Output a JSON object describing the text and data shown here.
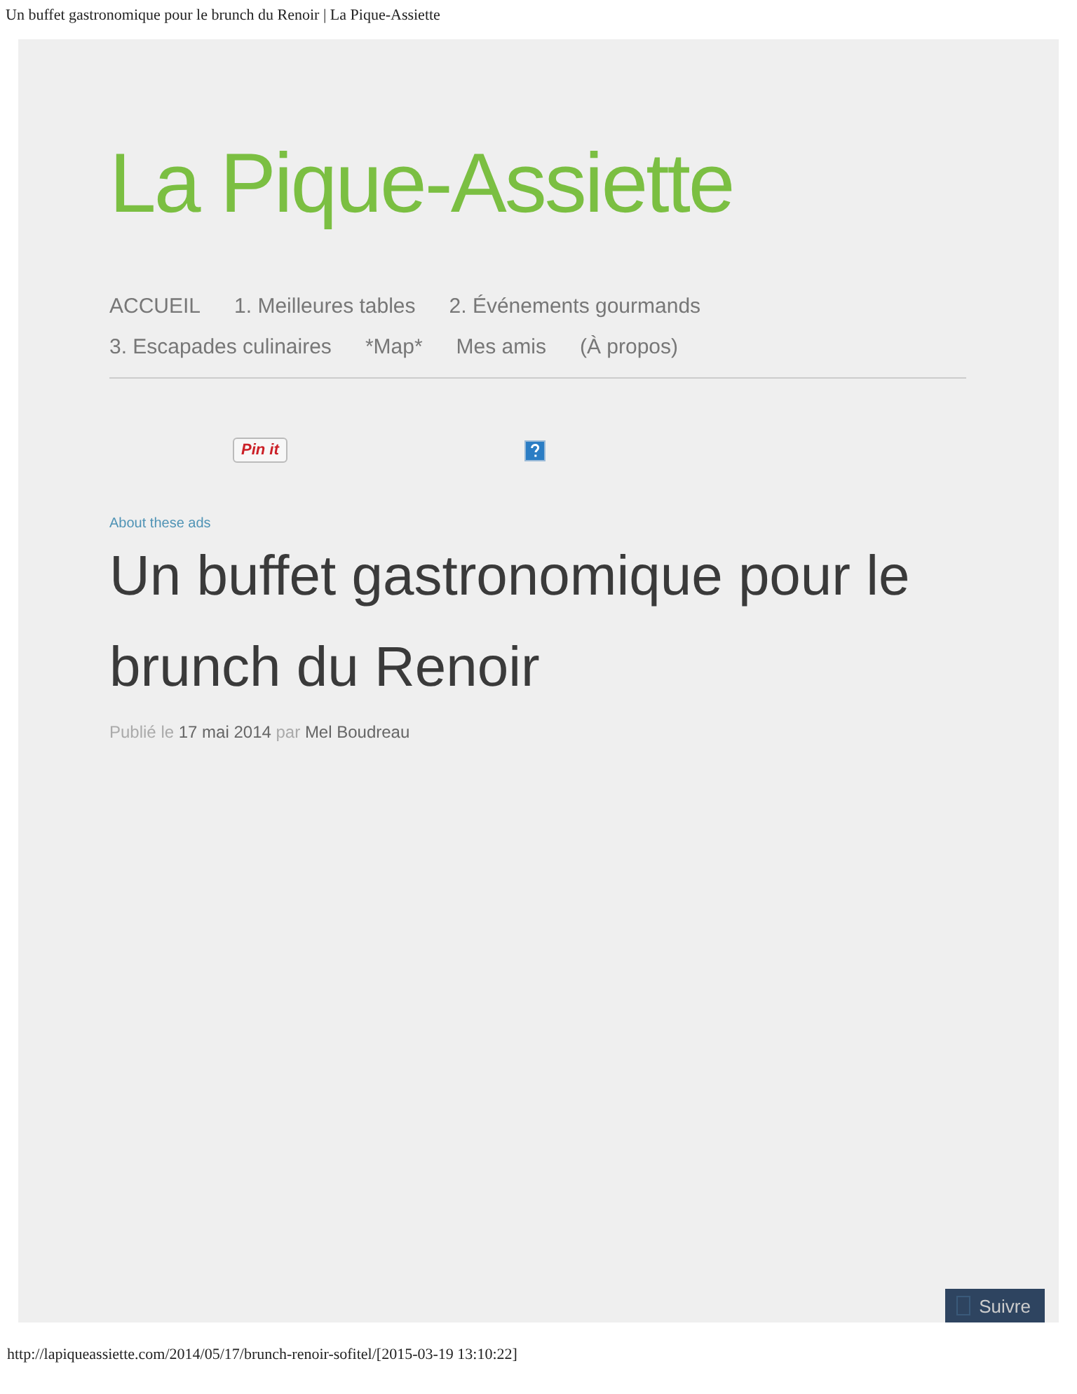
{
  "page_title": "Un buffet gastronomique pour le brunch du Renoir | La Pique-Assiette",
  "site_title": "La Pique-Assiette",
  "nav": {
    "rows": [
      [
        "ACCUEIL",
        "1. Meilleures tables",
        "2. Événements gourmands"
      ],
      [
        "3. Escapades culinaires",
        "*Map*",
        "Mes amis",
        "(À propos)"
      ]
    ]
  },
  "share": {
    "pin_label": "Pin it"
  },
  "ads_link": "About these ads",
  "post": {
    "title": "Un buffet gastronomique pour le brunch du Renoir",
    "published_label": "Publié le",
    "date": "17 mai 2014",
    "by_label": "par",
    "author": "Mel Boudreau"
  },
  "follow_button": "Suivre",
  "footer_url": "http://lapiqueassiette.com/2014/05/17/brunch-renoir-sofitel/[2015-03-19 13:10:22]"
}
